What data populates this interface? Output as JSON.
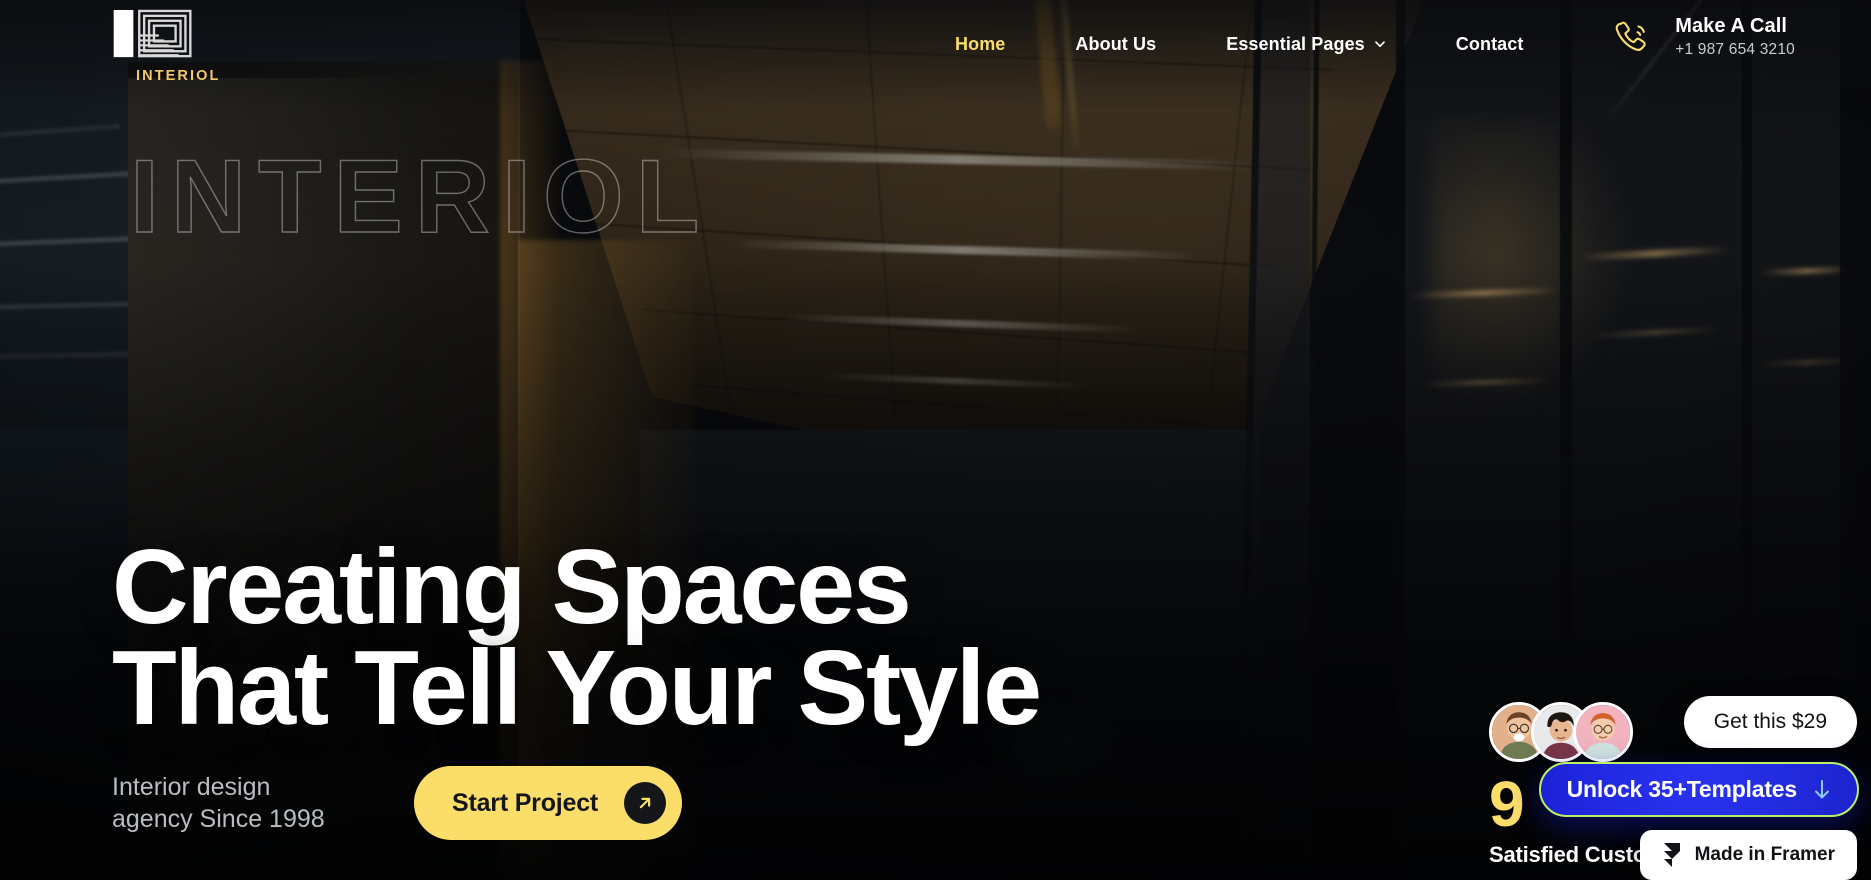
{
  "brand": {
    "logo_word": "INTERIOL",
    "logo_icon": "nested-squares-logo-icon",
    "accent_color": "#FBDE6A",
    "logo_word_color": "#F3C969"
  },
  "nav": {
    "items": [
      {
        "label": "Home",
        "active": true,
        "has_dropdown": false
      },
      {
        "label": "About Us",
        "active": false,
        "has_dropdown": false
      },
      {
        "label": "Essential Pages",
        "active": false,
        "has_dropdown": true
      },
      {
        "label": "Contact",
        "active": false,
        "has_dropdown": false
      }
    ]
  },
  "call": {
    "icon": "phone-call-icon",
    "title": "Make A Call",
    "number": "+1 987 654 3210"
  },
  "hero": {
    "watermark": "INTERIOL",
    "headline_line1": "Creating Spaces",
    "headline_line2": "That Tell Your Style",
    "subtext": "Interior design agency Since 1998",
    "cta_label": "Start Project",
    "cta_icon": "arrow-up-right-icon"
  },
  "proof": {
    "avatar_count": 3,
    "avatars": [
      {
        "name": "avatar-customer-1",
        "bg": "#E2B089"
      },
      {
        "name": "avatar-customer-2",
        "bg": "#E9E9EC"
      },
      {
        "name": "avatar-customer-3",
        "bg": "#F2B3BF"
      }
    ],
    "number": "9",
    "label": "Satisfied Customers"
  },
  "widgets": {
    "price_badge": "Get this $29",
    "unlock_badge": "Unlock 35+Templates",
    "unlock_icon": "download-arrow-icon",
    "framer_badge": "Made in Framer",
    "framer_icon": "framer-logo-icon",
    "unlock_border_color": "#B9F06A",
    "unlock_bg_color": "#2029E0"
  }
}
